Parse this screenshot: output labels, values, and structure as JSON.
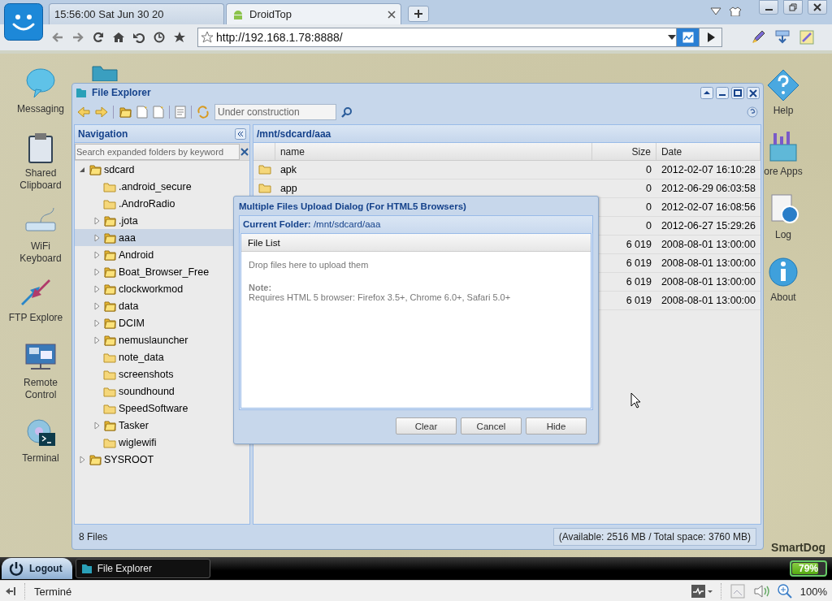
{
  "browser": {
    "tabs": [
      {
        "label": "15:56:00 Sat Jun 30 20",
        "selected": false
      },
      {
        "label": "DroidTop",
        "selected": true
      }
    ],
    "address": "http://192.168.1.78:8888/"
  },
  "desktop": {
    "left_icons": [
      {
        "lines": [
          "Messaging"
        ]
      },
      {
        "lines": [
          "Shared",
          "Clipboard"
        ]
      },
      {
        "lines": [
          "WiFi",
          "Keyboard"
        ]
      },
      {
        "lines": [
          "FTP Explore"
        ]
      },
      {
        "lines": [
          "Remote",
          "Control"
        ]
      },
      {
        "lines": [
          "Terminal"
        ]
      }
    ],
    "right_icons": [
      {
        "lines": [
          "Help"
        ]
      },
      {
        "lines": [
          "ore Apps"
        ]
      },
      {
        "lines": [
          "Log"
        ]
      },
      {
        "lines": [
          "About"
        ]
      }
    ],
    "logo_text": "SmartDog"
  },
  "file_explorer": {
    "title": "File Explorer",
    "search_placeholder": "Under construction",
    "navigation": {
      "title": "Navigation",
      "filter_placeholder": "Search expanded folders by keyword",
      "tree": [
        {
          "label": "sdcard",
          "expandable": true,
          "expanded": true,
          "selected": false,
          "children": [
            {
              "label": ".android_secure",
              "expandable": false,
              "selected": false
            },
            {
              "label": ".AndroRadio",
              "expandable": false,
              "selected": false
            },
            {
              "label": ".jota",
              "expandable": true,
              "selected": false
            },
            {
              "label": "aaa",
              "expandable": true,
              "selected": true
            },
            {
              "label": "Android",
              "expandable": true,
              "selected": false
            },
            {
              "label": "Boat_Browser_Free",
              "expandable": true,
              "selected": false
            },
            {
              "label": "clockworkmod",
              "expandable": true,
              "selected": false
            },
            {
              "label": "data",
              "expandable": true,
              "selected": false
            },
            {
              "label": "DCIM",
              "expandable": true,
              "selected": false
            },
            {
              "label": "nemuslauncher",
              "expandable": true,
              "selected": false
            },
            {
              "label": "note_data",
              "expandable": false,
              "selected": false
            },
            {
              "label": "screenshots",
              "expandable": false,
              "selected": false
            },
            {
              "label": "soundhound",
              "expandable": false,
              "selected": false
            },
            {
              "label": "SpeedSoftware",
              "expandable": false,
              "selected": false
            },
            {
              "label": "Tasker",
              "expandable": true,
              "selected": false
            },
            {
              "label": "wiglewifi",
              "expandable": false,
              "selected": false
            }
          ]
        },
        {
          "label": "SYSROOT",
          "expandable": true,
          "selected": false
        }
      ]
    },
    "path": "/mnt/sdcard/aaa",
    "columns": [
      "name",
      "Size",
      "Date"
    ],
    "rows": [
      {
        "kind": "folder",
        "name": "apk",
        "size": "0",
        "date": "2012-02-07 16:10:28"
      },
      {
        "kind": "folder",
        "name": "app",
        "size": "0",
        "date": "2012-06-29 06:03:58"
      },
      {
        "size": "0",
        "date": "2012-02-07 16:08:56"
      },
      {
        "size": "0",
        "date": "2012-06-27 15:29:26"
      },
      {
        "size": "6 019",
        "date": "2008-08-01 13:00:00"
      },
      {
        "size": "6 019",
        "date": "2008-08-01 13:00:00"
      },
      {
        "size": "6 019",
        "date": "2008-08-01 13:00:00"
      },
      {
        "size": "6 019",
        "date": "2008-08-01 13:00:00"
      }
    ],
    "count": "8 Files",
    "space": "(Available: 2516 MB / Total space: 3760 MB)"
  },
  "upload_dialog": {
    "title": "Multiple Files Upload Dialog (For HTML5 Browsers)",
    "current_folder": "**Current Folder:** /mnt/sdcard/aaa",
    "list_title": "File List",
    "drop_hint": "Drop files here to upload them",
    "note_title": "Note:",
    "note": "Requires HTML 5 browser: Firefox 3.5+, Chrome 6.0+, Safari 5.0+",
    "buttons": [
      "Clear",
      "Cancel",
      "Hide"
    ]
  },
  "taskbar": {
    "start": "Logout",
    "tasks": [
      {
        "label": "File Explorer"
      }
    ],
    "battery": {
      "level": 0.79,
      "label": "79%"
    }
  },
  "status_bar": {
    "text": "Terminé",
    "zoom": "100%"
  }
}
